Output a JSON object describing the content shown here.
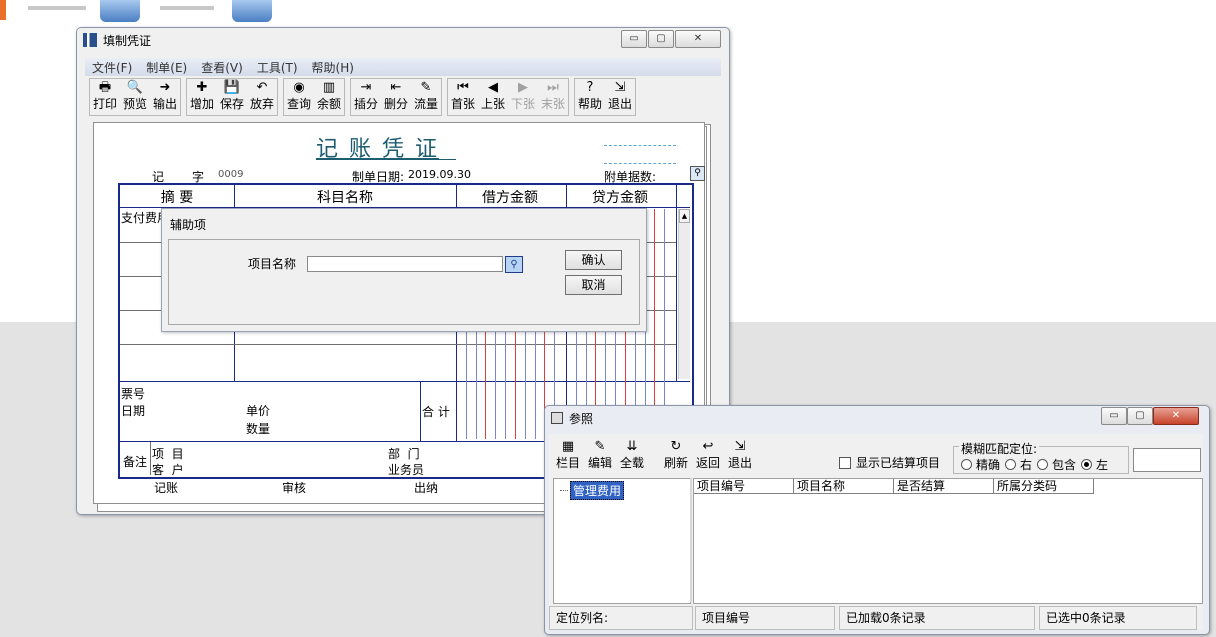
{
  "voucher_window": {
    "title": "填制凭证",
    "menu": [
      "文件(F)",
      "制单(E)",
      "查看(V)",
      "工具(T)",
      "帮助(H)"
    ],
    "toolbar": [
      {
        "label": "打印",
        "icon": "printer-icon",
        "glyph": "🖶",
        "enabled": true
      },
      {
        "label": "预览",
        "icon": "preview-icon",
        "glyph": "🔍",
        "enabled": true
      },
      {
        "label": "输出",
        "icon": "export-icon",
        "glyph": "➜",
        "enabled": true
      },
      {
        "label": "增加",
        "icon": "add-icon",
        "glyph": "✚",
        "enabled": true
      },
      {
        "label": "保存",
        "icon": "save-icon",
        "glyph": "💾",
        "enabled": true
      },
      {
        "label": "放弃",
        "icon": "undo-icon",
        "glyph": "↶",
        "enabled": true
      },
      {
        "label": "查询",
        "icon": "binoculars-icon",
        "glyph": "◉",
        "enabled": true
      },
      {
        "label": "余额",
        "icon": "bar-chart-icon",
        "glyph": "▥",
        "enabled": true
      },
      {
        "label": "插分",
        "icon": "insert-row-icon",
        "glyph": "⇥",
        "enabled": true
      },
      {
        "label": "删分",
        "icon": "delete-row-icon",
        "glyph": "⇤",
        "enabled": true
      },
      {
        "label": "流量",
        "icon": "cashflow-icon",
        "glyph": "✎",
        "enabled": true
      },
      {
        "label": "首张",
        "icon": "first-icon",
        "glyph": "⏮",
        "enabled": true
      },
      {
        "label": "上张",
        "icon": "prev-icon",
        "glyph": "◀",
        "enabled": true
      },
      {
        "label": "下张",
        "icon": "next-icon",
        "glyph": "▶",
        "enabled": false
      },
      {
        "label": "末张",
        "icon": "last-icon",
        "glyph": "⏭",
        "enabled": false
      },
      {
        "label": "帮助",
        "icon": "help-icon",
        "glyph": "?",
        "enabled": true
      },
      {
        "label": "退出",
        "icon": "exit-icon",
        "glyph": "⇲",
        "enabled": true
      }
    ],
    "voucher": {
      "title": "记 账 凭 证",
      "type_label": "记",
      "type_char": "字",
      "number": "0009",
      "date_label": "制单日期:",
      "date": "2019.09.30",
      "attach_label": "附单据数:",
      "columns": [
        "摘 要",
        "科目名称",
        "借方金额",
        "贷方金额"
      ],
      "first_row_summary": "支付费用",
      "ticket_label": "票号",
      "date_row_label": "日期",
      "unit_price_label": "单价",
      "quantity_label": "数量",
      "total_label": "合 计",
      "remark_label": "备注",
      "project_label": "项  目",
      "customer_label": "客  户",
      "dept_label": "部  门",
      "salesman_label": "业务员",
      "bookkeep_label": "记账",
      "review_label": "审核",
      "cashier_label": "出纳"
    }
  },
  "aux_dialog": {
    "title": "辅助项",
    "field_label": "项目名称",
    "field_value": "",
    "confirm_label": "确认",
    "cancel_label": "取消"
  },
  "ref_window": {
    "title": "参照",
    "toolbar": [
      {
        "label": "栏目",
        "icon": "columns-icon",
        "glyph": "▦"
      },
      {
        "label": "编辑",
        "icon": "edit-icon",
        "glyph": "✎"
      },
      {
        "label": "全载",
        "icon": "load-all-icon",
        "glyph": "⇊"
      },
      {
        "label": "刷新",
        "icon": "refresh-icon",
        "glyph": "↻"
      },
      {
        "label": "返回",
        "icon": "return-icon",
        "glyph": "↩"
      },
      {
        "label": "退出",
        "icon": "exit-icon",
        "glyph": "⇲"
      }
    ],
    "show_settled_label": "显示已结算项目",
    "show_settled_checked": false,
    "fuzzy_label": "模糊匹配定位:",
    "match_options": [
      {
        "label": "精确",
        "checked": false
      },
      {
        "label": "右",
        "checked": false
      },
      {
        "label": "包含",
        "checked": false
      },
      {
        "label": "左",
        "checked": true
      }
    ],
    "search_value": "",
    "tree_items": [
      "管理费用"
    ],
    "grid_columns": [
      "项目编号",
      "项目名称",
      "是否结算",
      "所属分类码"
    ],
    "status": [
      "定位列名:",
      "项目编号",
      "已加载0条记录",
      "已选中0条记录"
    ]
  }
}
